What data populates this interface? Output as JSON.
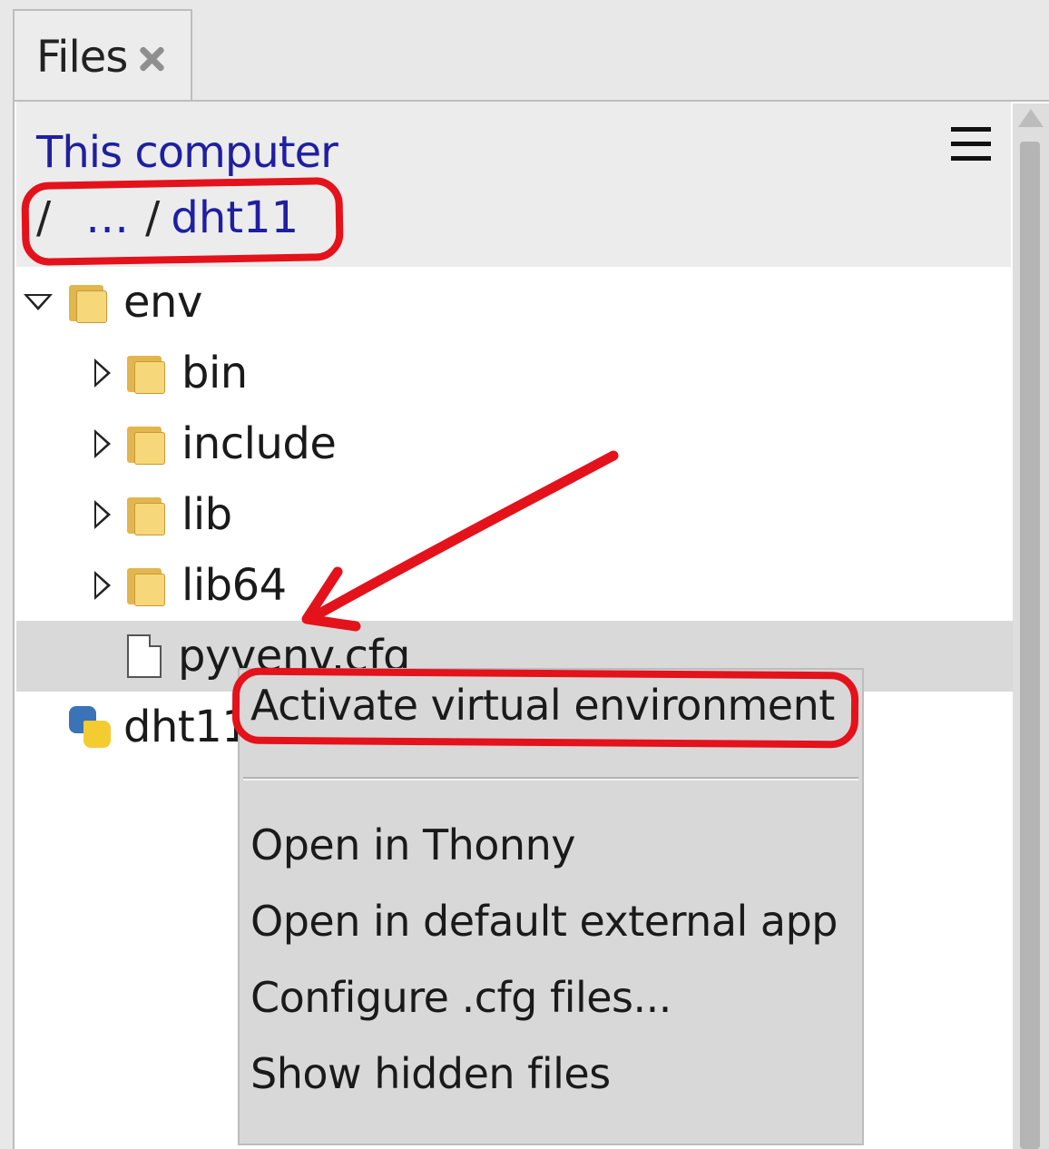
{
  "tab": {
    "label": "Files",
    "close_icon": "close-icon"
  },
  "location": {
    "root_label": "This computer",
    "breadcrumb": {
      "root": "/",
      "ellipsis": "…",
      "separator": "/",
      "current": "dht11"
    },
    "menu_icon": "hamburger-menu-icon"
  },
  "tree": {
    "env": "env",
    "bin": "bin",
    "include": "include",
    "lib": "lib",
    "lib64": "lib64",
    "pyvenv": "pyvenv.cfg",
    "dht11": "dht11"
  },
  "context_menu": {
    "activate": "Activate virtual environment",
    "open_thonny": "Open in Thonny",
    "open_external": "Open in default external app",
    "configure": "Configure .cfg files...",
    "show_hidden": "Show hidden files"
  },
  "annotation_color": "#e3121b"
}
